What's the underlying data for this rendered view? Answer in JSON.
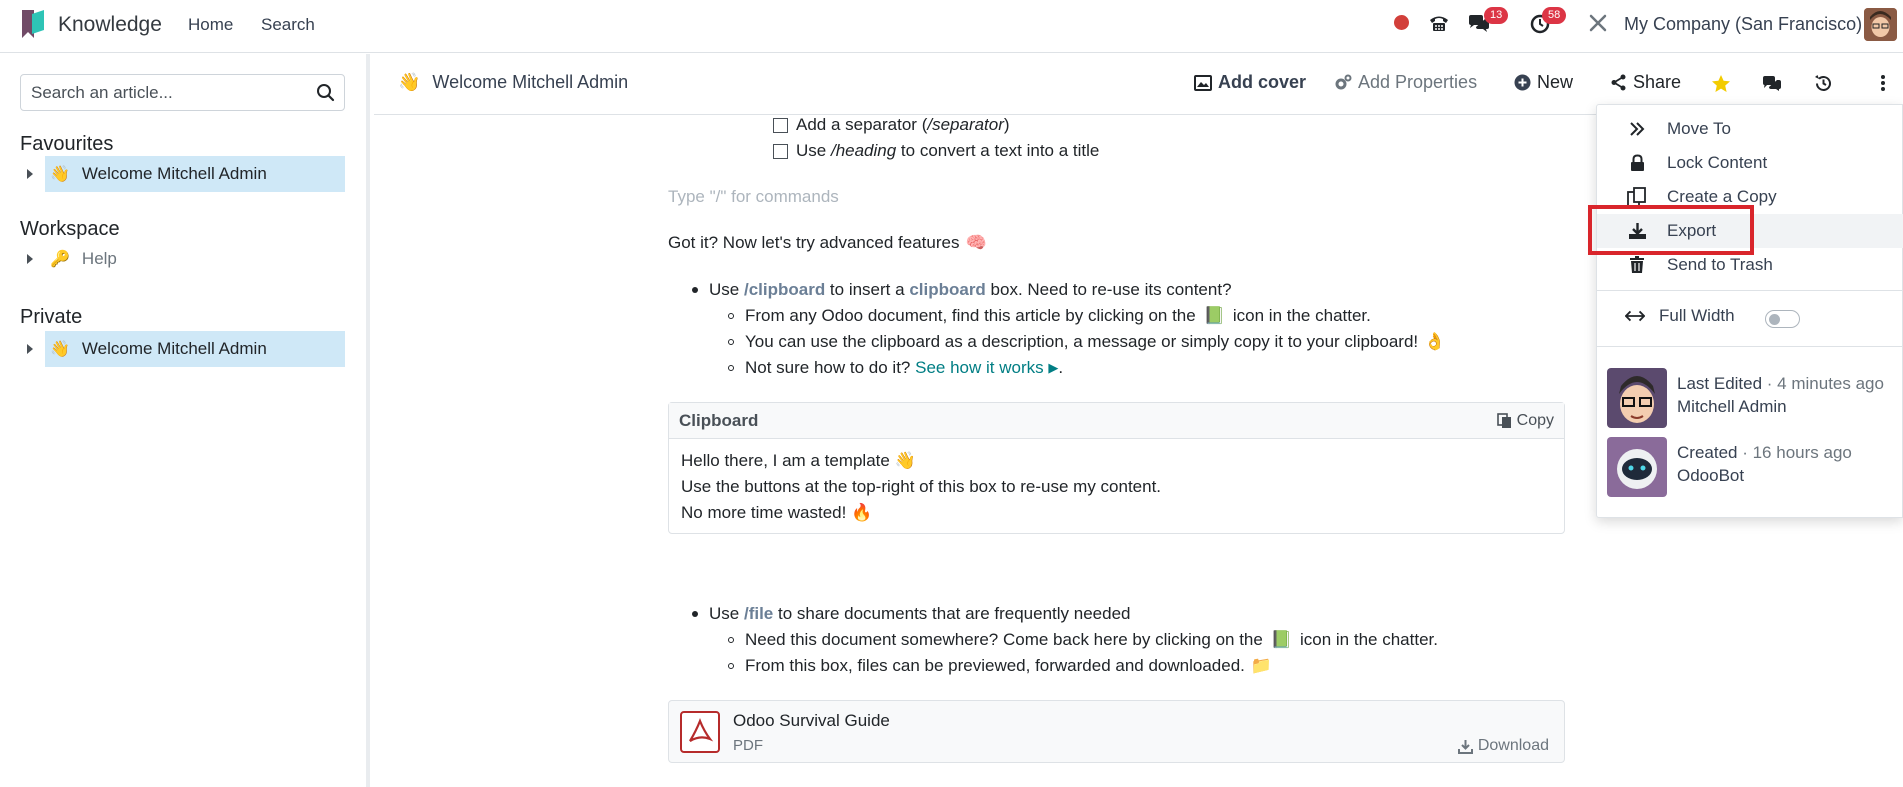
{
  "navbar": {
    "app_name": "Knowledge",
    "menu": [
      "Home",
      "Search"
    ],
    "messages_badge": "13",
    "activities_badge": "58",
    "company": "My Company (San Francisco)"
  },
  "sidebar": {
    "search_placeholder": "Search an article...",
    "sections": [
      {
        "title": "Favourites",
        "items": [
          {
            "emoji": "👋",
            "label": "Welcome Mitchell Admin"
          }
        ]
      },
      {
        "title": "Workspace",
        "items": [
          {
            "emoji": "🔑",
            "label": "Help"
          }
        ]
      },
      {
        "title": "Private",
        "items": [
          {
            "emoji": "👋",
            "label": "Welcome Mitchell Admin"
          }
        ]
      }
    ]
  },
  "article_header": {
    "emoji": "👋",
    "title": "Welcome Mitchell Admin",
    "add_cover": "Add cover",
    "add_properties": "Add Properties",
    "new": "New",
    "share": "Share"
  },
  "content": {
    "checklist": [
      {
        "prefix": "Add a separator (",
        "code": "/separator",
        "suffix": ")"
      },
      {
        "prefix": "Use ",
        "code": "/heading",
        "suffix": " to convert a text into a title"
      }
    ],
    "command_hint": "Type \"/\" for commands",
    "advanced_intro": "Got it? Now let's try advanced features",
    "advanced_emoji": "🧠",
    "clipboard_bullet": {
      "use": "Use ",
      "cmd": "/clipboard",
      "mid": " to insert a ",
      "kw": "clipboard",
      "rest": " box. Need to re-use its content?"
    },
    "clipboard_sub": [
      {
        "text": "From any Odoo document, find this article by clicking on the",
        "icon": "📗",
        "after": "icon in the chatter."
      },
      {
        "text": "You can use the clipboard as a description, a message or simply copy it to your clipboard!",
        "icon": "👌",
        "after": ""
      },
      {
        "text": "Not sure how to do it?",
        "link": "See how it works",
        "icon": "▶",
        "after": "."
      }
    ],
    "clipboard_box": {
      "title": "Clipboard",
      "copy": "Copy",
      "lines": [
        "Hello there, I am a template 👋",
        "Use the buttons at the top-right of this box to re-use my content.",
        "No more time wasted! 🔥"
      ]
    },
    "file_bullet": {
      "use": "Use ",
      "cmd": "/file",
      "rest": " to share documents that are frequently needed"
    },
    "file_sub": [
      {
        "text": "Need this document somewhere? Come back here by clicking on the",
        "icon": "📗",
        "after": "icon in the chatter."
      },
      {
        "text": "From this box, files can be previewed, forwarded and downloaded.",
        "icon": "📁",
        "after": ""
      }
    ],
    "file_box": {
      "name": "Odoo Survival Guide",
      "type": "PDF",
      "download": "Download"
    }
  },
  "dropdown": {
    "items": [
      {
        "icon": "move-to-icon",
        "label": "Move To"
      },
      {
        "icon": "lock-icon",
        "label": "Lock Content"
      },
      {
        "icon": "copy-icon",
        "label": "Create a Copy"
      },
      {
        "icon": "export-icon",
        "label": "Export"
      },
      {
        "icon": "trash-icon",
        "label": "Send to Trash"
      }
    ],
    "full_width": "Full Width",
    "last_edited": {
      "label": "Last Edited",
      "time": "· 4 minutes ago",
      "name": "Mitchell Admin"
    },
    "created": {
      "label": "Created",
      "time": "· 16 hours ago",
      "name": "OdooBot"
    }
  },
  "colors": {
    "accent": "#017e84",
    "highlight": "#d9252b",
    "active_item": "#cfe8f7",
    "badge": "#dc3545"
  }
}
